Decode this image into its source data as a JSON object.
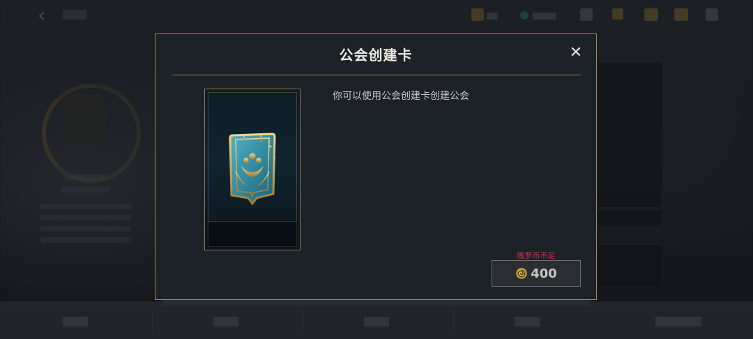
{
  "modal": {
    "title": "公会创建卡",
    "close_glyph": "✕",
    "description": "你可以使用公会创建卡创建公会",
    "insufficient_text": "魄罗币不足",
    "price": "400",
    "coin_icon": "poro-coin-icon",
    "accent_color": "#a38a55",
    "warning_color": "#c0394a"
  },
  "background": {
    "back_glyph": "‹"
  }
}
